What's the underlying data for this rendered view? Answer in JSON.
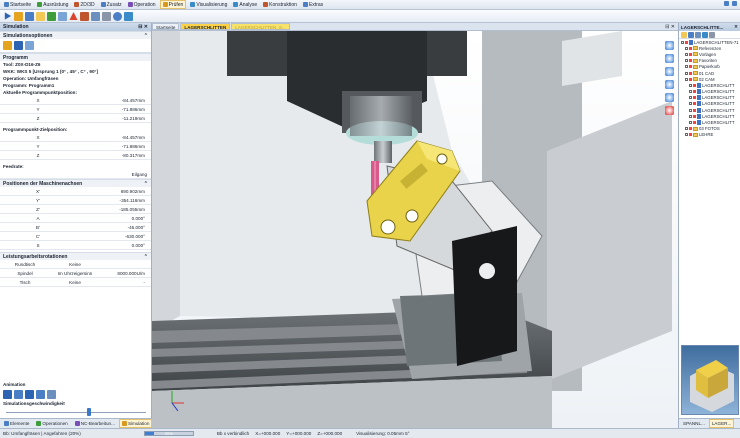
{
  "menubar": {
    "items": [
      {
        "label": "Startseite",
        "icon": "home-icon",
        "color": "#4a7fc6"
      },
      {
        "label": "Ausrüstung",
        "icon": "tool-icon",
        "color": "#3f9c3a"
      },
      {
        "label": "2D/3D",
        "icon": "shape-icon",
        "color": "#c0562e"
      },
      {
        "label": "Zusatz",
        "icon": "plus-icon",
        "color": "#4a7fc6"
      },
      {
        "label": "Operation",
        "icon": "operation-icon",
        "color": "#7a4fb5"
      },
      {
        "label": "Prüfen",
        "icon": "check-icon",
        "color": "#d99820",
        "active": true
      },
      {
        "label": "Visualisierung",
        "icon": "eye-icon",
        "color": "#3a8bc9"
      },
      {
        "label": "Analyse",
        "icon": "analysis-icon",
        "color": "#3a8bc9"
      },
      {
        "label": "Konstruktion",
        "icon": "construct-icon",
        "color": "#c0562e"
      },
      {
        "label": "Extras",
        "icon": "extras-icon",
        "color": "#4a7fc6"
      }
    ]
  },
  "left_panel": {
    "title": "Simulation",
    "sim_options": "Simulationsoptionen",
    "program_head": "Programm",
    "tool": "Tool: Z0X-D16-Z6",
    "wkk": "WKK: WKS 5 [Ursprung 1 (0° , 45° , C° , 90°]",
    "operation": "Operation: Umfangfräsen",
    "program": "Programm: Programm1",
    "current_pos_head": "Aktuelle Programmpunktposition:",
    "current_pos": [
      {
        "axis": "X",
        "value": "-84.457mm"
      },
      {
        "axis": "Y",
        "value": "-71.886mm"
      },
      {
        "axis": "Z",
        "value": "-11.219mm"
      }
    ],
    "target_head": "Programmpunkt-Zielposition:",
    "target_pos": [
      {
        "axis": "X",
        "value": "-84.457mm"
      },
      {
        "axis": "Y",
        "value": "-71.886mm"
      },
      {
        "axis": "Z",
        "value": "-80.317mm"
      }
    ],
    "feed_head": "Feedrate:",
    "feed_value": "Eilgang",
    "machine_head": "Positionen der Maschinenachsen",
    "machine_pos": [
      {
        "axis": "X'",
        "value": "690.902mm"
      },
      {
        "axis": "Y'",
        "value": "-354.116mm"
      },
      {
        "axis": "Z'",
        "value": "-185.055mm"
      },
      {
        "axis": "A",
        "value": "0.000°"
      },
      {
        "axis": "B'",
        "value": "-45.000°"
      },
      {
        "axis": "C'",
        "value": "-630.000°"
      },
      {
        "axis": "S",
        "value": "0.000°"
      }
    ],
    "work_head": "Leistungsarbeitsrotationen",
    "work_rows": [
      {
        "c1": "Rundtisch",
        "c2": "Keine",
        "c3": ""
      },
      {
        "c1": "Spindel",
        "c2": "Im Uhrzeigersinn",
        "c3": "8000.000U/m"
      },
      {
        "c1": "Tisch",
        "c2": "Keine",
        "c3": "-"
      }
    ],
    "animation_head": "Animation",
    "speed_head": "Simulationsgeschwindigkeit",
    "speed_fraction": 0.58
  },
  "bottom_tabs": [
    {
      "label": "Elemente",
      "icon": "elements-icon",
      "color": "#4a7fc6"
    },
    {
      "label": "Operationen",
      "icon": "operations-icon",
      "color": "#3f9c3a"
    },
    {
      "label": "NC-Bearbeitun...",
      "icon": "nc-icon",
      "color": "#7a4fb5"
    },
    {
      "label": "Simulation",
      "icon": "simulation-icon",
      "color": "#d99820",
      "active": true
    }
  ],
  "viewport": {
    "tabs": [
      {
        "label": "Startseite",
        "active": false
      },
      {
        "label": "LAGERSCHLITTEN",
        "active": true
      }
    ],
    "ghost_tab": "LAGERSCHLITTEN_S..."
  },
  "right_panel": {
    "title": "LAGERSCHLITTE...",
    "tree": [
      {
        "label": "LAGERSCHLITTEN-71",
        "depth": 0,
        "type": "doc"
      },
      {
        "label": "Referenzen",
        "depth": 1,
        "type": "folder"
      },
      {
        "label": "Vorlagen",
        "depth": 1,
        "type": "folder"
      },
      {
        "label": "Favoriten",
        "depth": 1,
        "type": "folder"
      },
      {
        "label": "Papierkorb",
        "depth": 1,
        "type": "folder"
      },
      {
        "label": "01 CAD",
        "depth": 1,
        "type": "folder"
      },
      {
        "label": "02 CAM",
        "depth": 1,
        "type": "folder"
      },
      {
        "label": "LAGERSCHLITT",
        "depth": 2,
        "type": "doc"
      },
      {
        "label": "LAGERSCHLITT",
        "depth": 2,
        "type": "doc"
      },
      {
        "label": "LAGERSCHLITT",
        "depth": 2,
        "type": "doc"
      },
      {
        "label": "LAGERSCHLITT",
        "depth": 2,
        "type": "doc"
      },
      {
        "label": "LAGERSCHLITT",
        "depth": 2,
        "type": "doc"
      },
      {
        "label": "LAGERSCHLITT",
        "depth": 2,
        "type": "doc"
      },
      {
        "label": "LAGERSCHLITT",
        "depth": 2,
        "type": "doc"
      },
      {
        "label": "03 FOTOS",
        "depth": 1,
        "type": "folder"
      },
      {
        "label": "LEHRE",
        "depth": 1,
        "type": "folder"
      }
    ],
    "tabs": [
      {
        "label": "SPANNL...",
        "active": false
      },
      {
        "label": "LAGER...",
        "active": true
      }
    ]
  },
  "statusbar": {
    "left": "Bb: Umfangfräsen | Angefahren (20%)",
    "progress_fraction": 0.2,
    "progress_label": "20%",
    "bb": "Bb x verbindlich",
    "x": "X=+000.000",
    "y": "Y=+000.000",
    "z": "Z=+000.000",
    "zoom": "Visualisierung: 0.05mm 5°"
  }
}
